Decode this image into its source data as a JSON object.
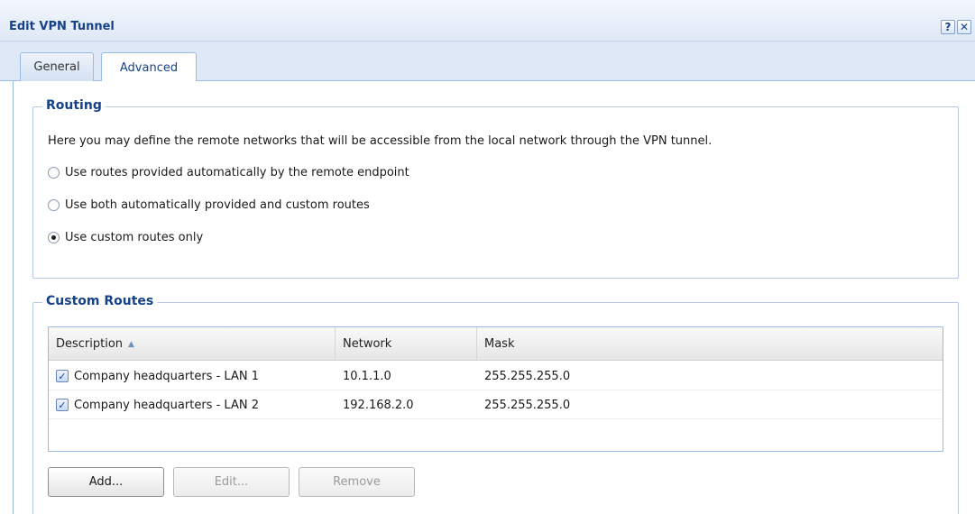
{
  "window": {
    "title": "Edit VPN Tunnel",
    "help_label": "?",
    "close_label": "✕"
  },
  "tabs": [
    {
      "label": "General",
      "active": false
    },
    {
      "label": "Advanced",
      "active": true
    }
  ],
  "routing": {
    "legend": "Routing",
    "description": "Here you may define the remote networks that will be accessible from the local network through the VPN tunnel.",
    "options": [
      {
        "label": "Use routes provided automatically by the remote endpoint",
        "selected": false
      },
      {
        "label": "Use both automatically provided and custom routes",
        "selected": false
      },
      {
        "label": "Use custom routes only",
        "selected": true
      }
    ]
  },
  "custom_routes": {
    "legend": "Custom Routes",
    "columns": [
      "Description",
      "Network",
      "Mask"
    ],
    "sort_indicator": "▲",
    "rows": [
      {
        "checked": true,
        "description": "Company headquarters - LAN 1",
        "network": "10.1.1.0",
        "mask": "255.255.255.0"
      },
      {
        "checked": true,
        "description": "Company headquarters - LAN 2",
        "network": "192.168.2.0",
        "mask": "255.255.255.0"
      }
    ],
    "check_glyph": "✓",
    "buttons": {
      "add": "Add...",
      "edit": "Edit...",
      "remove": "Remove"
    }
  },
  "colors": {
    "title_text": "#15428b",
    "panel_border": "#99bbe8",
    "tab_strip": "#dfe8f6"
  }
}
